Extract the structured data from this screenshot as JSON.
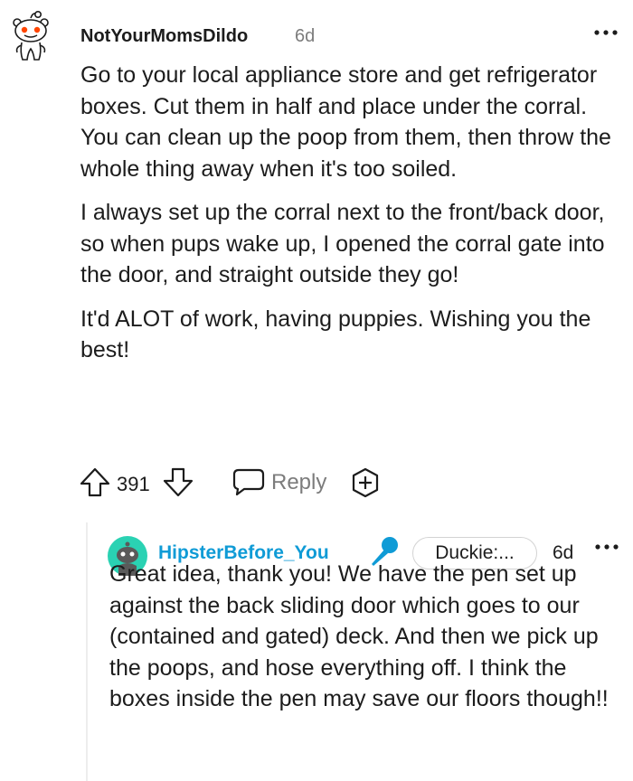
{
  "comment": {
    "author": "NotYourMomsDildo",
    "age": "6d",
    "paragraphs": [
      "Go to your local appliance store and get refrigerator boxes. Cut them in half and place under the corral. You can clean up the poop from them, then throw the whole thing away when it's too soiled.",
      "I always set up the corral next to the front/back door, so when pups wake up, I opened the corral gate into the door, and straight outside they go!",
      "It'd ALOT of work, having puppies. Wishing you the best!"
    ],
    "vote_count": "391",
    "reply_label": "Reply",
    "icons": {
      "avatar": "snoo-avatar-icon",
      "upvote": "upvote-arrow-icon",
      "downvote": "downvote-arrow-icon",
      "reply": "speech-bubble-icon",
      "award": "add-award-icon",
      "more": "more-options-icon"
    }
  },
  "reply": {
    "author": "HipsterBefore_You",
    "flair": "Duckie:...",
    "age": "6d",
    "body": "Great idea, thank you! We have the pen set up against the back sliding door which goes to our (contained and gated) deck. And then we pick up the poops, and hose everything off. I think the boxes inside the pen may save our floors though!!",
    "icons": {
      "avatar": "snoo-avatar-icon",
      "badge": "microphone-icon",
      "more": "more-options-icon"
    }
  },
  "colors": {
    "text": "#1c1c1c",
    "muted": "#7c7c7c",
    "reply_author": "#0f9bd6",
    "avatar_teal": "#2ad2b3",
    "snoo_orange": "#ff4500",
    "mic_blue": "#0f9bd6"
  }
}
